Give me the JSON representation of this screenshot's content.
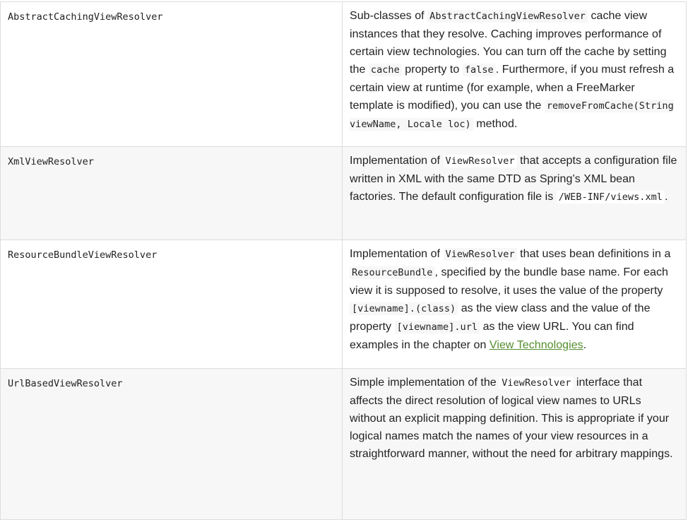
{
  "rows": [
    {
      "name": "AbstractCachingViewResolver",
      "desc": {
        "t1": "Sub-classes of ",
        "c1": "AbstractCachingViewResolver",
        "t2": " cache view instances that they resolve. Caching improves performance of certain view technologies. You can turn off the cache by setting the ",
        "c2": "cache",
        "t3": " property to ",
        "c3": "false",
        "t4": ". Furthermore, if you must refresh a certain view at runtime (for example, when a FreeMarker template is modified), you can use the ",
        "c4": "removeFromCache(String viewName, Locale loc)",
        "t5": " method."
      }
    },
    {
      "name": "XmlViewResolver",
      "desc": {
        "t1": "Implementation of ",
        "c1": "ViewResolver",
        "t2": " that accepts a configuration file written in XML with the same DTD as Spring’s XML bean factories. The default configuration file is ",
        "c2": "/WEB-INF/views.xml",
        "t3": "."
      }
    },
    {
      "name": "ResourceBundleViewResolver",
      "desc": {
        "t1": "Implementation of ",
        "c1": "ViewResolver",
        "t2": " that uses bean definitions in a ",
        "c2": "ResourceBundle",
        "t3": ", specified by the bundle base name. For each view it is supposed to resolve, it uses the value of the property ",
        "c3": "[viewname].(class)",
        "t4": " as the view class and the value of the property ",
        "c4": "[viewname].url",
        "t5": " as the view URL. You can find examples in the chapter on ",
        "link": "View Technologies",
        "t6": "."
      }
    },
    {
      "name": "UrlBasedViewResolver",
      "desc": {
        "t1": "Simple implementation of the ",
        "c1": "ViewResolver",
        "t2": " interface that affects the direct resolution of logical view names to URLs without an explicit mapping definition. This is appropriate if your logical names match the names of your view resources in a straightforward manner, without the need for arbitrary mappings."
      }
    }
  ]
}
